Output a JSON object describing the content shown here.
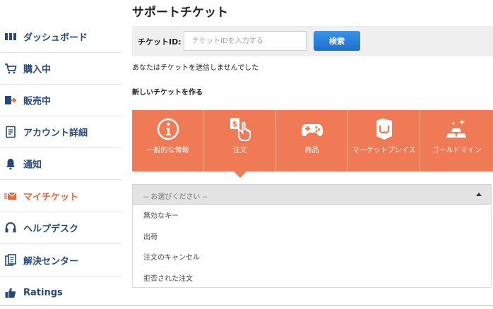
{
  "colors": {
    "brand": "#27497a",
    "active": "#e8673d",
    "category_bg": "#f07a56",
    "search_button": "#2a80dd"
  },
  "sidebar": {
    "items": [
      {
        "label": "ダッシュボード",
        "icon": "dashboard-icon"
      },
      {
        "label": "購入中",
        "icon": "cart-icon"
      },
      {
        "label": "販売中",
        "icon": "sell-icon"
      },
      {
        "label": "アカウント詳細",
        "icon": "account-icon"
      },
      {
        "label": "通知",
        "icon": "bell-icon"
      },
      {
        "label": "マイチケット",
        "icon": "ticket-icon",
        "active": true
      },
      {
        "label": "ヘルプデスク",
        "icon": "headset-icon"
      },
      {
        "label": "解決センター",
        "icon": "resolution-icon"
      },
      {
        "label": "Ratings",
        "icon": "thumbs-up-icon"
      }
    ]
  },
  "main": {
    "title": "サポートチケット",
    "search": {
      "label": "チケットID:",
      "placeholder": "チケットIDを入力する",
      "value": "",
      "button": "検索"
    },
    "no_ticket_text": "あなたはチケットを送信しませんでした",
    "new_ticket_heading": "新しいチケットを作る",
    "categories": [
      {
        "label": "一般的な情報",
        "icon": "info-icon"
      },
      {
        "label": "注文",
        "icon": "order-hand-icon",
        "selected": true
      },
      {
        "label": "商品",
        "icon": "gamepad-icon"
      },
      {
        "label": "マーケットプレイス",
        "icon": "marketplace-bag-icon"
      },
      {
        "label": "ゴールドマイン",
        "icon": "gold-bars-icon"
      }
    ],
    "select": {
      "selected": "-- お選びください --",
      "options": [
        "無効なキー",
        "出荷",
        "注文のキャンセル",
        "拒否された注文"
      ]
    }
  }
}
